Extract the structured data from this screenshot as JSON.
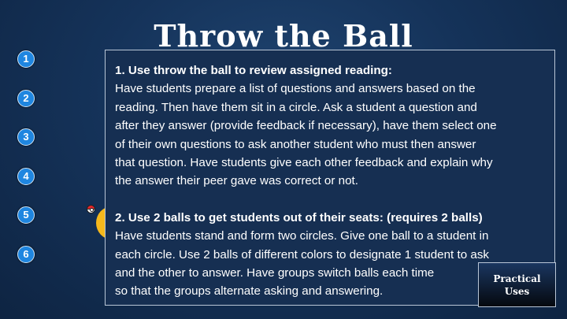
{
  "title": "Throw the Ball",
  "nav": [
    "1",
    "2",
    "3",
    "4",
    "5",
    "6"
  ],
  "sections": [
    {
      "heading": "1. Use throw the ball to review assigned reading:",
      "lines": [
        "Have students prepare a list of questions and answers based on the",
        "reading. Then have them sit in a circle. Ask a student a question and",
        "after they answer (provide feedback if necessary), have them select one",
        "of their own questions to ask another student who must then answer",
        "that question. Have students give each other feedback and explain why",
        "the answer their peer gave was correct or not."
      ]
    },
    {
      "heading": "2. Use 2 balls to get students out of their seats: (requires 2 balls)",
      "lines": [
        "Have students stand and form two circles. Give one ball to a student in",
        "each circle. Use 2 balls of different colors to designate 1 student to ask",
        "and the other to answer. Have groups switch balls each time",
        "so that the groups alternate asking and answering."
      ]
    }
  ],
  "practical_uses": {
    "line1": "Practical",
    "line2": "Uses"
  },
  "colors": {
    "background": "#15335a",
    "nav_circle": "#1f86e0",
    "accent": "#f5b81c"
  },
  "icons": {
    "decor": "pokeball-icon"
  }
}
